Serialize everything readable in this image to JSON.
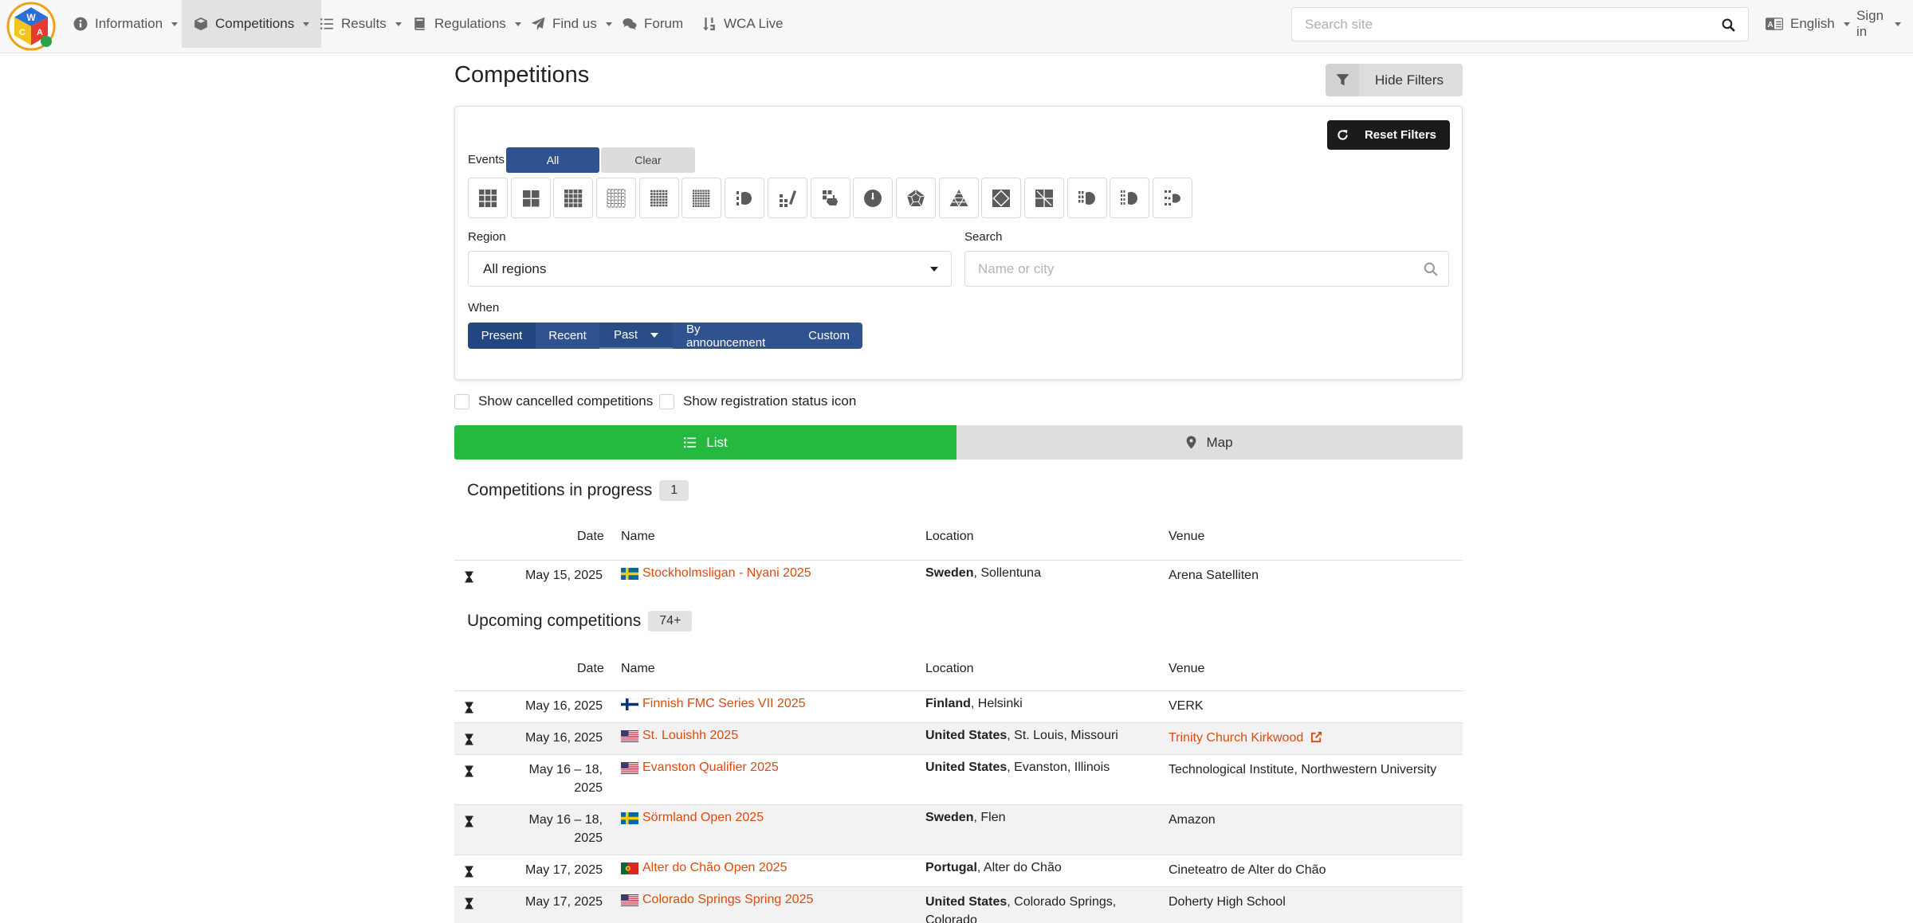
{
  "nav": {
    "items": [
      {
        "label": "Information",
        "icon": "info-circle-icon"
      },
      {
        "label": "Competitions",
        "icon": "cube-icon"
      },
      {
        "label": "Results",
        "icon": "list-ol-icon"
      },
      {
        "label": "Regulations",
        "icon": "book-icon"
      },
      {
        "label": "Find us",
        "icon": "paper-plane-icon"
      },
      {
        "label": "Forum",
        "icon": "comments-icon"
      },
      {
        "label": "WCA Live",
        "icon": "sort-numeric-icon"
      }
    ],
    "search_placeholder": "Search site",
    "language": "English",
    "sign_in": "Sign in"
  },
  "page": {
    "title": "Competitions",
    "hide_filters": "Hide Filters"
  },
  "filters": {
    "reset": "Reset Filters",
    "events_label": "Events",
    "all": "All",
    "clear": "Clear",
    "events": [
      "3x3x3 Cube",
      "2x2x2 Cube",
      "4x4x4 Cube",
      "5x5x5 Cube",
      "6x6x6 Cube",
      "7x7x7 Cube",
      "3x3x3 Blindfolded",
      "3x3x3 Fewest Moves",
      "3x3x3 One-Handed",
      "Clock",
      "Megaminx",
      "Pyraminx",
      "Skewb",
      "Square-1",
      "4x4x4 Blindfolded",
      "5x5x5 Blindfolded",
      "3x3x3 Multi-Blind"
    ],
    "region_label": "Region",
    "region_value": "All regions",
    "search_label": "Search",
    "search_placeholder": "Name or city",
    "when_label": "When",
    "when_options": [
      "Present",
      "Recent",
      "Past",
      "By announcement",
      "Custom"
    ]
  },
  "options": {
    "show_cancelled": "Show cancelled competitions",
    "show_registration": "Show registration status icon"
  },
  "view_tabs": {
    "list": "List",
    "map": "Map"
  },
  "table_headers": {
    "date": "Date",
    "name": "Name",
    "location": "Location",
    "venue": "Venue"
  },
  "in_progress": {
    "title": "Competitions in progress",
    "count": "1",
    "rows": [
      {
        "date": "May 15, 2025",
        "name": "Stockholmsligan - Nyani 2025",
        "flag": "SE",
        "country": "Sweden",
        "city": ", Sollentuna",
        "venue": "Arena Satelliten"
      }
    ]
  },
  "upcoming": {
    "title": "Upcoming competitions",
    "count": "74+",
    "rows": [
      {
        "date": "May 16, 2025",
        "name": "Finnish FMC Series VII 2025",
        "flag": "FI",
        "country": "Finland",
        "city": ", Helsinki",
        "venue": "VERK"
      },
      {
        "date": "May 16, 2025",
        "name": "St. Louishh 2025",
        "flag": "US",
        "country": "United States",
        "city": ", St. Louis, Missouri",
        "venue": "Trinity Church Kirkwood",
        "venue_link": true
      },
      {
        "date": "May 16 – 18, 2025",
        "name": "Evanston Qualifier 2025",
        "flag": "US",
        "country": "United States",
        "city": ", Evanston, Illinois",
        "venue": "Technological Institute, Northwestern University"
      },
      {
        "date": "May 16 – 18, 2025",
        "name": "Sörmland Open 2025",
        "flag": "SE",
        "country": "Sweden",
        "city": ", Flen",
        "venue": "Amazon"
      },
      {
        "date": "May 17, 2025",
        "name": "Alter do Chão Open 2025",
        "flag": "PT",
        "country": "Portugal",
        "city": ", Alter do Chão",
        "venue": "Cineteatro de Alter do Chão"
      },
      {
        "date": "May 17, 2025",
        "name": "Colorado Springs Spring 2025",
        "flag": "US",
        "country": "United States",
        "city": ", Colorado Springs, Colorado",
        "venue": "Doherty High School"
      }
    ]
  }
}
